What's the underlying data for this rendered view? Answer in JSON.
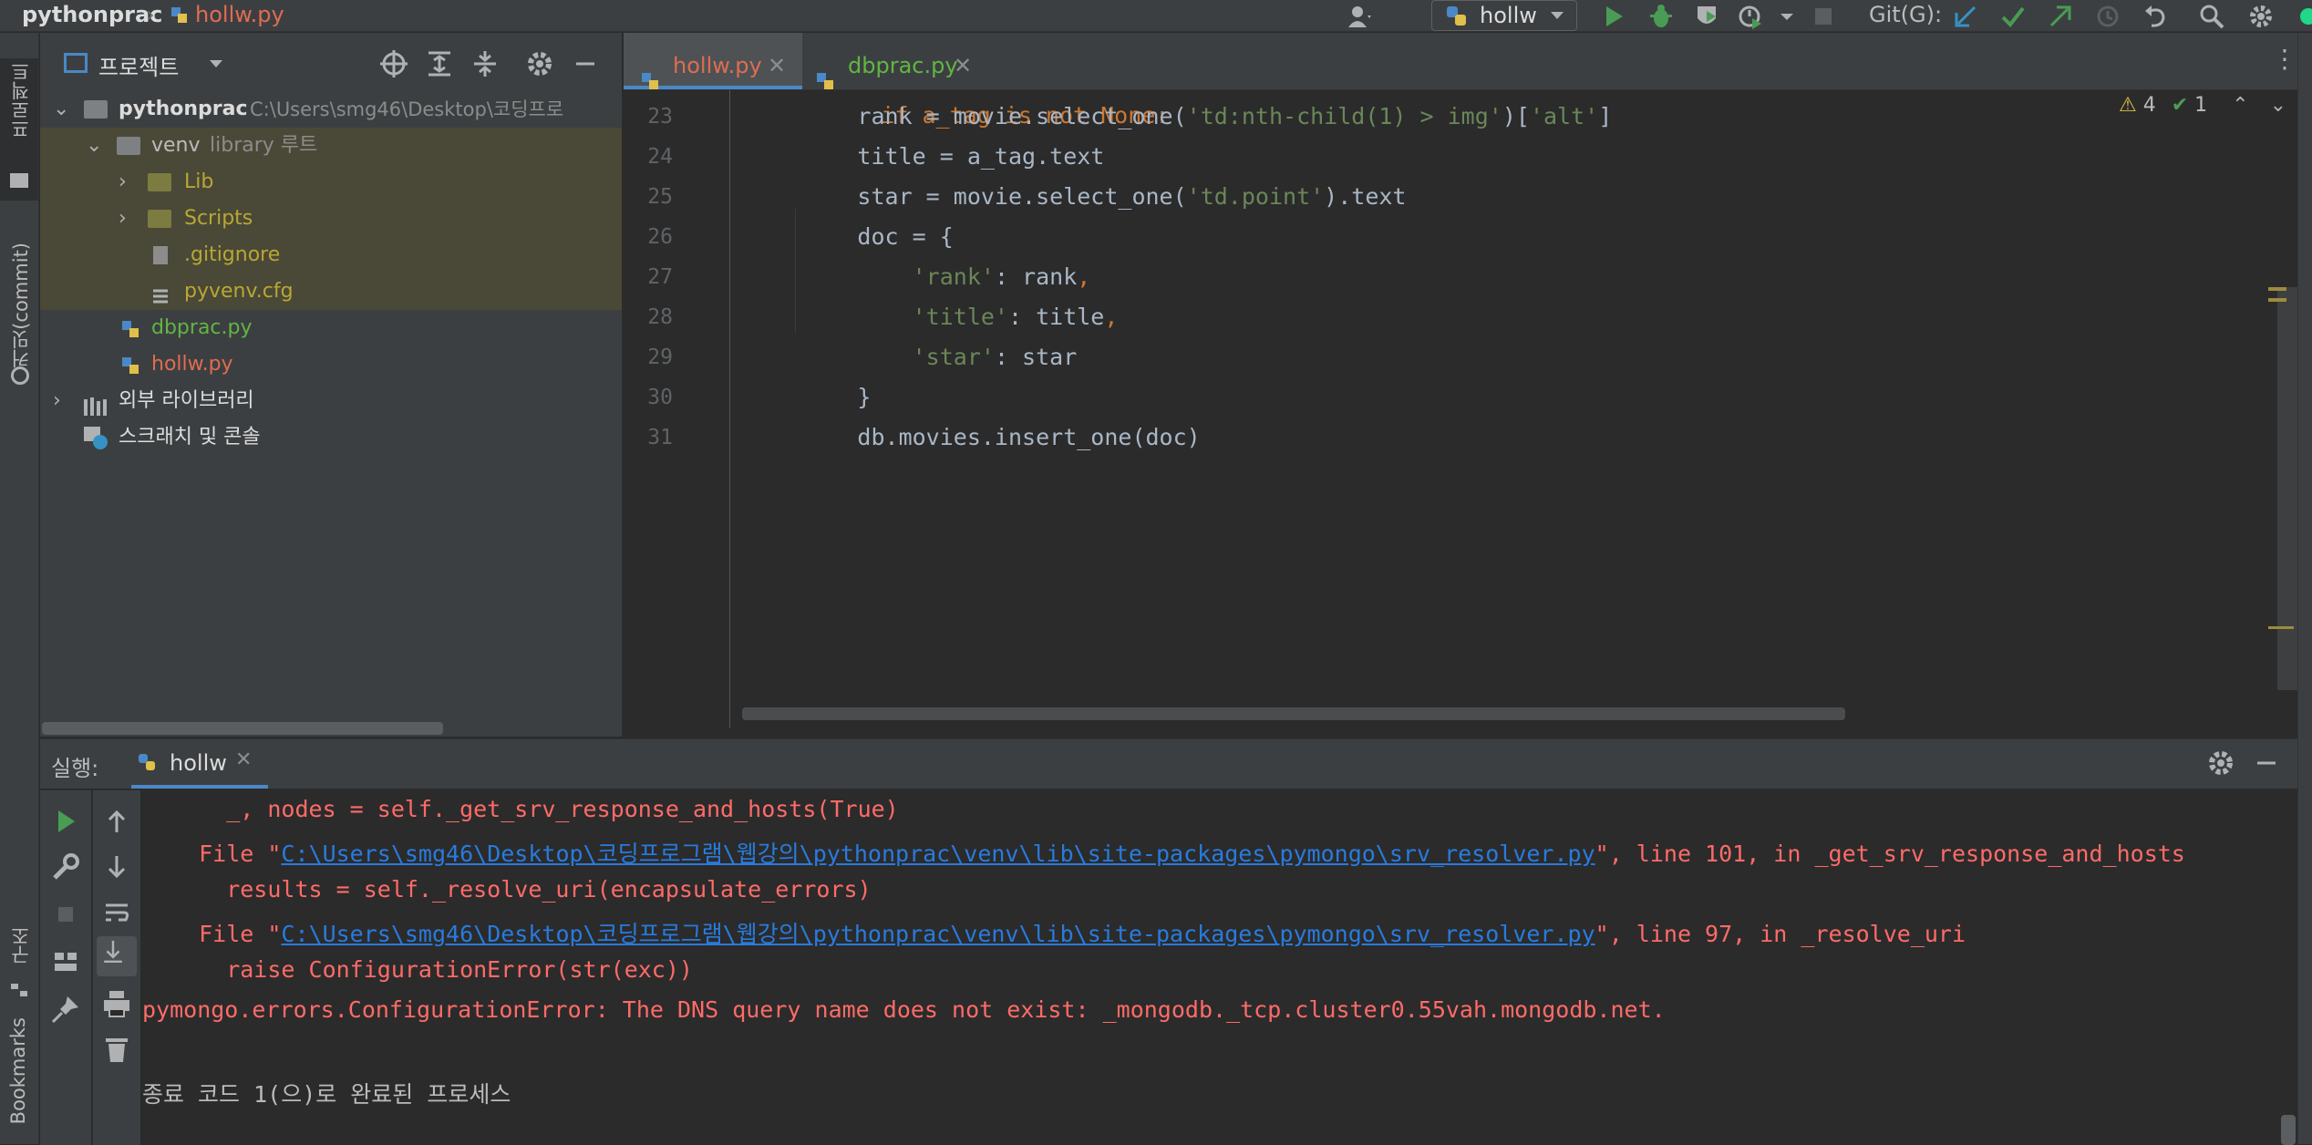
{
  "breadcrumb": {
    "project": "pythonprac",
    "file": "hollw.py"
  },
  "toolbar": {
    "run_config": "hollw",
    "git_label": "Git(G):"
  },
  "left_strip": {
    "project_tab": "프로젝트",
    "commit_tab": "커밋(commit)",
    "structure_tab": "구조",
    "bookmarks_tab": "Bookmarks"
  },
  "project_panel": {
    "title": "프로젝트",
    "root": {
      "name": "pythonprac",
      "path": "C:\\Users\\smg46\\Desktop\\코딩프로"
    },
    "venv": {
      "name": "venv",
      "hint": "library 루트"
    },
    "items": [
      {
        "name": "Lib"
      },
      {
        "name": "Scripts"
      },
      {
        "name": ".gitignore"
      },
      {
        "name": "pyvenv.cfg"
      },
      {
        "name": "dbprac.py"
      },
      {
        "name": "hollw.py"
      },
      {
        "name": "외부 라이브러리"
      },
      {
        "name": "스크래치 및 콘솔"
      }
    ]
  },
  "editor": {
    "tabs": [
      {
        "label": "hollw.py"
      },
      {
        "label": "dbprac.py"
      }
    ],
    "warnings": "4",
    "checks": "1",
    "partial_top_line": "if a_tag is not None:",
    "lines": [
      {
        "num": "23",
        "indent": "        ",
        "a": "rank = movie.select_one(",
        "s1": "'td:nth-child(1) > img'",
        "b": ")[",
        "s2": "'alt'",
        "c": "]"
      },
      {
        "num": "24",
        "indent": "        ",
        "a": "title = a_tag.text"
      },
      {
        "num": "25",
        "indent": "        ",
        "a": "star = movie.select_one(",
        "s1": "'td.point'",
        "b": ").text"
      },
      {
        "num": "26",
        "indent": "        ",
        "a": "doc = {"
      },
      {
        "num": "27",
        "indent": "            ",
        "s1": "'rank'",
        "b": ": rank",
        "k": ","
      },
      {
        "num": "28",
        "indent": "            ",
        "s1": "'title'",
        "b": ": title",
        "k": ","
      },
      {
        "num": "29",
        "indent": "            ",
        "s1": "'star'",
        "b": ": star"
      },
      {
        "num": "30",
        "indent": "        ",
        "a": "}"
      },
      {
        "num": "31",
        "indent": "        ",
        "a": "db.movies.insert_one(doc)"
      }
    ]
  },
  "run_panel": {
    "label": "실행:",
    "tab": "hollw",
    "output": {
      "l1": "    _, nodes = self._get_srv_response_and_hosts(True)",
      "l2_pre": "  File \"",
      "l2_link": "C:\\Users\\smg46\\Desktop\\코딩프로그램\\웹강의\\pythonprac\\venv\\lib\\site-packages\\pymongo\\srv_resolver.py",
      "l2_post": "\", line 101, in _get_srv_response_and_hosts",
      "l3": "    results = self._resolve_uri(encapsulate_errors)",
      "l4_pre": "  File \"",
      "l4_link": "C:\\Users\\smg46\\Desktop\\코딩프로그램\\웹강의\\pythonprac\\venv\\lib\\site-packages\\pymongo\\srv_resolver.py",
      "l4_post": "\", line 97, in _resolve_uri",
      "l5": "    raise ConfigurationError(str(exc))",
      "l6": "pymongo.errors.ConfigurationError: The DNS query name does not exist: _mongodb._tcp.cluster0.55vah.mongodb.net.",
      "exit": "종료 코드 1(으)로 완료된 프로세스"
    }
  }
}
